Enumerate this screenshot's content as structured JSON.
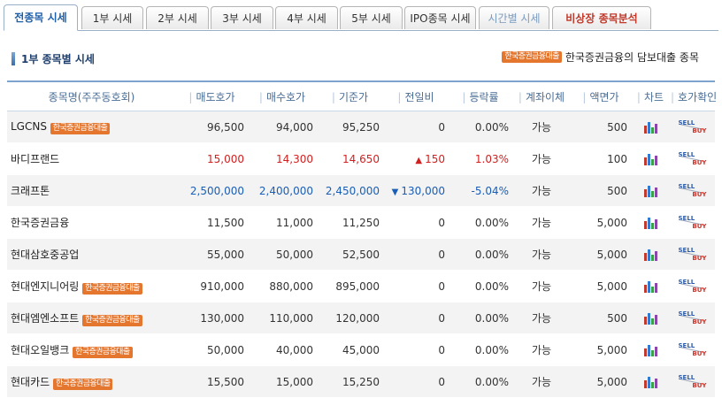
{
  "tabs": [
    {
      "label": "전종목 시세",
      "state": "active"
    },
    {
      "label": "1부 시세",
      "state": "normal"
    },
    {
      "label": "2부 시세",
      "state": "normal"
    },
    {
      "label": "3부 시세",
      "state": "normal"
    },
    {
      "label": "4부 시세",
      "state": "normal"
    },
    {
      "label": "5부 시세",
      "state": "normal"
    },
    {
      "label": "IPO종목 시세",
      "state": "normal"
    },
    {
      "label": "시간별 시세",
      "state": "disabled"
    },
    {
      "label": "비상장 종목분석",
      "state": "alert"
    }
  ],
  "section": {
    "title": "1부 종목별 시세",
    "legend_badge": "한국증권금융대출",
    "legend_text": "한국증권금융의 담보대출 종목"
  },
  "table": {
    "headers": [
      "종목명(주주동호회)",
      "매도호가",
      "매수호가",
      "기준가",
      "전일비",
      "등락률",
      "계좌이체",
      "액면가",
      "차트",
      "호가확인"
    ],
    "rows": [
      {
        "name": "LGCNS",
        "badge": "한국증권금융대출",
        "sell": "96,500",
        "buy": "94,000",
        "base": "95,250",
        "change": "0",
        "dir": "flat",
        "rate": "0.00%",
        "transfer": "가능",
        "face": "500"
      },
      {
        "name": "바디프랜드",
        "badge": "",
        "sell": "15,000",
        "buy": "14,300",
        "base": "14,650",
        "change": "150",
        "dir": "up",
        "rate": "1.03%",
        "transfer": "가능",
        "face": "100"
      },
      {
        "name": "크래프톤",
        "badge": "",
        "sell": "2,500,000",
        "buy": "2,400,000",
        "base": "2,450,000",
        "change": "130,000",
        "dir": "down",
        "rate": "-5.04%",
        "transfer": "가능",
        "face": "500"
      },
      {
        "name": "한국증권금융",
        "badge": "",
        "sell": "11,500",
        "buy": "11,000",
        "base": "11,250",
        "change": "0",
        "dir": "flat",
        "rate": "0.00%",
        "transfer": "가능",
        "face": "5,000"
      },
      {
        "name": "현대삼호중공업",
        "badge": "",
        "sell": "55,000",
        "buy": "50,000",
        "base": "52,500",
        "change": "0",
        "dir": "flat",
        "rate": "0.00%",
        "transfer": "가능",
        "face": "5,000"
      },
      {
        "name": "현대엔지니어링",
        "badge": "한국증권금융대출",
        "sell": "910,000",
        "buy": "880,000",
        "base": "895,000",
        "change": "0",
        "dir": "flat",
        "rate": "0.00%",
        "transfer": "가능",
        "face": "5,000"
      },
      {
        "name": "현대엠엔소프트",
        "badge": "한국증권금융대출",
        "sell": "130,000",
        "buy": "110,000",
        "base": "120,000",
        "change": "0",
        "dir": "flat",
        "rate": "0.00%",
        "transfer": "가능",
        "face": "500"
      },
      {
        "name": "현대오일뱅크",
        "badge": "한국증권금융대출",
        "sell": "50,000",
        "buy": "40,000",
        "base": "45,000",
        "change": "0",
        "dir": "flat",
        "rate": "0.00%",
        "transfer": "가능",
        "face": "5,000"
      },
      {
        "name": "현대카드",
        "badge": "한국증권금융대출",
        "sell": "15,500",
        "buy": "15,000",
        "base": "15,250",
        "change": "0",
        "dir": "flat",
        "rate": "0.00%",
        "transfer": "가능",
        "face": "5,000"
      }
    ]
  },
  "icons": {
    "chart": "bar-chart-icon",
    "quote": "sell-buy-icon",
    "sell_label": "SELL",
    "buy_label": "BUY",
    "up_arrow": "▲",
    "down_arrow": "▼"
  },
  "colors": {
    "up": "#d21f1f",
    "down": "#1a5eb6",
    "badge": "#e5762e",
    "header_text": "#4a6d96",
    "active_tab": "#1f5fa8",
    "alert_tab": "#c0392b"
  }
}
